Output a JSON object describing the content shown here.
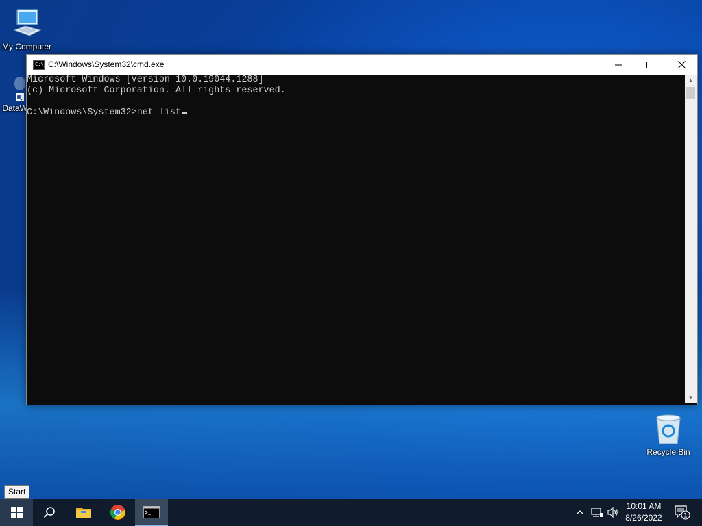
{
  "desktop": {
    "icons": [
      {
        "label": "My Computer"
      },
      {
        "label": "DataW"
      },
      {
        "label": "Recycle Bin"
      }
    ]
  },
  "cmd_window": {
    "title": "C:\\Windows\\System32\\cmd.exe",
    "icon_text": "C:\\_",
    "lines": [
      "Microsoft Windows [Version 10.0.19044.1288]",
      "(c) Microsoft Corporation. All rights reserved.",
      "",
      "C:\\Windows\\System32>net list"
    ],
    "colors": {
      "background": "#0c0c0c",
      "foreground": "#cccccc"
    }
  },
  "tooltip": {
    "text": "Start"
  },
  "taskbar": {
    "items": [
      "windows-logo-icon",
      "search-icon",
      "file-explorer-icon",
      "chrome-icon",
      "cmd-icon"
    ],
    "clock": {
      "time": "10:01 AM",
      "date": "8/26/2022"
    },
    "notification_count": "1",
    "tray_icons": [
      "chevron-up-icon",
      "network-icon",
      "volume-icon",
      "notification-icon"
    ]
  }
}
